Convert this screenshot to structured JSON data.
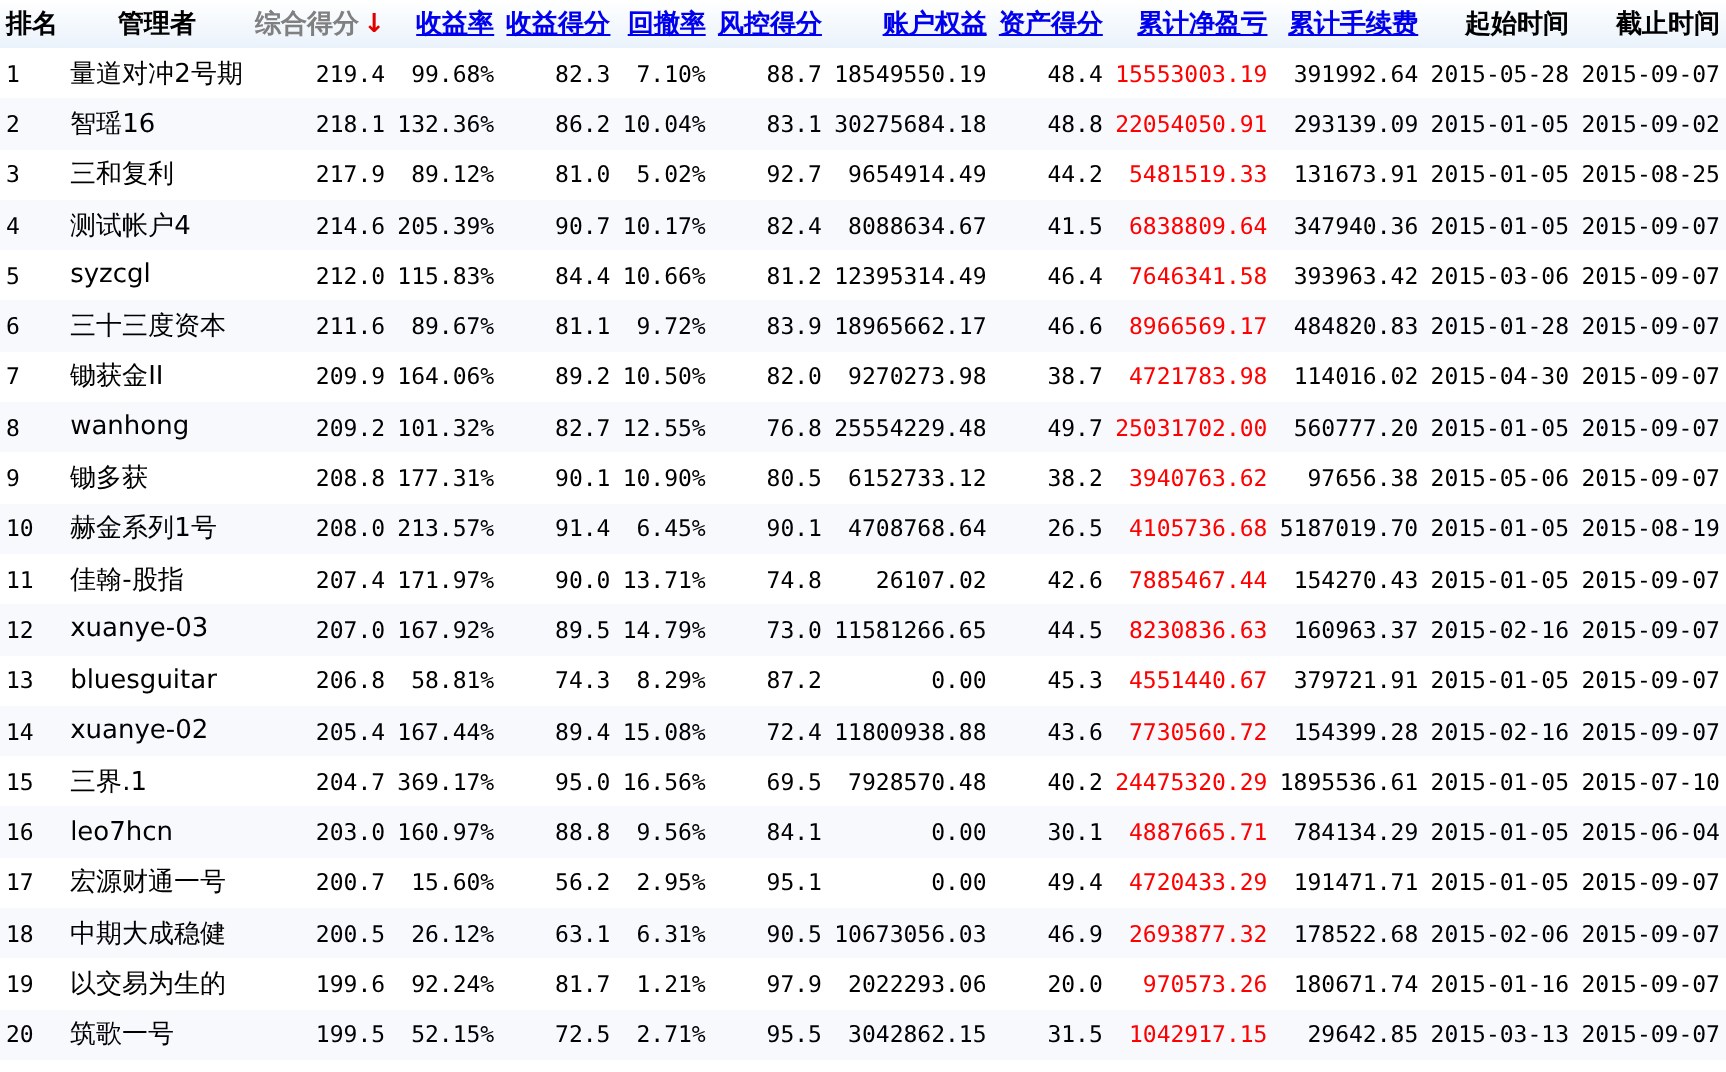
{
  "table": {
    "columns": [
      {
        "label": "排名",
        "kind": "plain",
        "color": "#000000"
      },
      {
        "label": "管理者",
        "kind": "plain",
        "color": "#000000"
      },
      {
        "label": "综合得分",
        "kind": "sorted",
        "sort_indicator": "↓",
        "color": "#000000"
      },
      {
        "label": "收益率",
        "kind": "link",
        "color": "#000000"
      },
      {
        "label": "收益得分",
        "kind": "link",
        "color": "#000000"
      },
      {
        "label": "回撤率",
        "kind": "link",
        "color": "#000000"
      },
      {
        "label": "风控得分",
        "kind": "link",
        "color": "#000000"
      },
      {
        "label": "账户权益",
        "kind": "link",
        "color": "#000000"
      },
      {
        "label": "资产得分",
        "kind": "link",
        "color": "#000000"
      },
      {
        "label": "累计净盈亏",
        "kind": "link",
        "color": "#ff0000"
      },
      {
        "label": "累计手续费",
        "kind": "link",
        "color": "#000000"
      },
      {
        "label": "起始时间",
        "kind": "plain",
        "color": "#000000"
      },
      {
        "label": "截止时间",
        "kind": "plain",
        "color": "#000000"
      }
    ],
    "rows": [
      [
        "1",
        "量道对冲2号期",
        "219.4",
        "99.68%",
        "82.3",
        "7.10%",
        "88.7",
        "18549550.19",
        "48.4",
        "15553003.19",
        "391992.64",
        "2015-05-28",
        "2015-09-07"
      ],
      [
        "2",
        "智瑶16",
        "218.1",
        "132.36%",
        "86.2",
        "10.04%",
        "83.1",
        "30275684.18",
        "48.8",
        "22054050.91",
        "293139.09",
        "2015-01-05",
        "2015-09-02"
      ],
      [
        "3",
        "三和复利",
        "217.9",
        "89.12%",
        "81.0",
        "5.02%",
        "92.7",
        "9654914.49",
        "44.2",
        "5481519.33",
        "131673.91",
        "2015-01-05",
        "2015-08-25"
      ],
      [
        "4",
        "测试帐户4",
        "214.6",
        "205.39%",
        "90.7",
        "10.17%",
        "82.4",
        "8088634.67",
        "41.5",
        "6838809.64",
        "347940.36",
        "2015-01-05",
        "2015-09-07"
      ],
      [
        "5",
        "syzcgl",
        "212.0",
        "115.83%",
        "84.4",
        "10.66%",
        "81.2",
        "12395314.49",
        "46.4",
        "7646341.58",
        "393963.42",
        "2015-03-06",
        "2015-09-07"
      ],
      [
        "6",
        "三十三度资本",
        "211.6",
        "89.67%",
        "81.1",
        "9.72%",
        "83.9",
        "18965662.17",
        "46.6",
        "8966569.17",
        "484820.83",
        "2015-01-28",
        "2015-09-07"
      ],
      [
        "7",
        "锄获金II",
        "209.9",
        "164.06%",
        "89.2",
        "10.50%",
        "82.0",
        "9270273.98",
        "38.7",
        "4721783.98",
        "114016.02",
        "2015-04-30",
        "2015-09-07"
      ],
      [
        "8",
        "wanhong",
        "209.2",
        "101.32%",
        "82.7",
        "12.55%",
        "76.8",
        "25554229.48",
        "49.7",
        "25031702.00",
        "560777.20",
        "2015-01-05",
        "2015-09-07"
      ],
      [
        "9",
        "锄多获",
        "208.8",
        "177.31%",
        "90.1",
        "10.90%",
        "80.5",
        "6152733.12",
        "38.2",
        "3940763.62",
        "97656.38",
        "2015-05-06",
        "2015-09-07"
      ],
      [
        "10",
        "赫金系列1号",
        "208.0",
        "213.57%",
        "91.4",
        "6.45%",
        "90.1",
        "4708768.64",
        "26.5",
        "4105736.68",
        "5187019.70",
        "2015-01-05",
        "2015-08-19"
      ],
      [
        "11",
        "佳翰-股指",
        "207.4",
        "171.97%",
        "90.0",
        "13.71%",
        "74.8",
        "26107.02",
        "42.6",
        "7885467.44",
        "154270.43",
        "2015-01-05",
        "2015-09-07"
      ],
      [
        "12",
        "xuanye-03",
        "207.0",
        "167.92%",
        "89.5",
        "14.79%",
        "73.0",
        "11581266.65",
        "44.5",
        "8230836.63",
        "160963.37",
        "2015-02-16",
        "2015-09-07"
      ],
      [
        "13",
        "bluesguitar",
        "206.8",
        "58.81%",
        "74.3",
        "8.29%",
        "87.2",
        "0.00",
        "45.3",
        "4551440.67",
        "379721.91",
        "2015-01-05",
        "2015-09-07"
      ],
      [
        "14",
        "xuanye-02",
        "205.4",
        "167.44%",
        "89.4",
        "15.08%",
        "72.4",
        "11800938.88",
        "43.6",
        "7730560.72",
        "154399.28",
        "2015-02-16",
        "2015-09-07"
      ],
      [
        "15",
        "三界.1",
        "204.7",
        "369.17%",
        "95.0",
        "16.56%",
        "69.5",
        "7928570.48",
        "40.2",
        "24475320.29",
        "1895536.61",
        "2015-01-05",
        "2015-07-10"
      ],
      [
        "16",
        "leo7hcn",
        "203.0",
        "160.97%",
        "88.8",
        "9.56%",
        "84.1",
        "0.00",
        "30.1",
        "4887665.71",
        "784134.29",
        "2015-01-05",
        "2015-06-04"
      ],
      [
        "17",
        "宏源财通一号",
        "200.7",
        "15.60%",
        "56.2",
        "2.95%",
        "95.1",
        "0.00",
        "49.4",
        "4720433.29",
        "191471.71",
        "2015-01-05",
        "2015-09-07"
      ],
      [
        "18",
        "中期大成稳健",
        "200.5",
        "26.12%",
        "63.1",
        "6.31%",
        "90.5",
        "10673056.03",
        "46.9",
        "2693877.32",
        "178522.68",
        "2015-02-06",
        "2015-09-07"
      ],
      [
        "19",
        "以交易为生的",
        "199.6",
        "92.24%",
        "81.7",
        "1.21%",
        "97.9",
        "2022293.06",
        "20.0",
        "970573.26",
        "180671.74",
        "2015-01-16",
        "2015-09-07"
      ],
      [
        "20",
        "筑歌一号",
        "199.5",
        "52.15%",
        "72.5",
        "2.71%",
        "95.5",
        "3042862.15",
        "31.5",
        "1042917.15",
        "29642.85",
        "2015-03-13",
        "2015-09-07"
      ]
    ]
  }
}
